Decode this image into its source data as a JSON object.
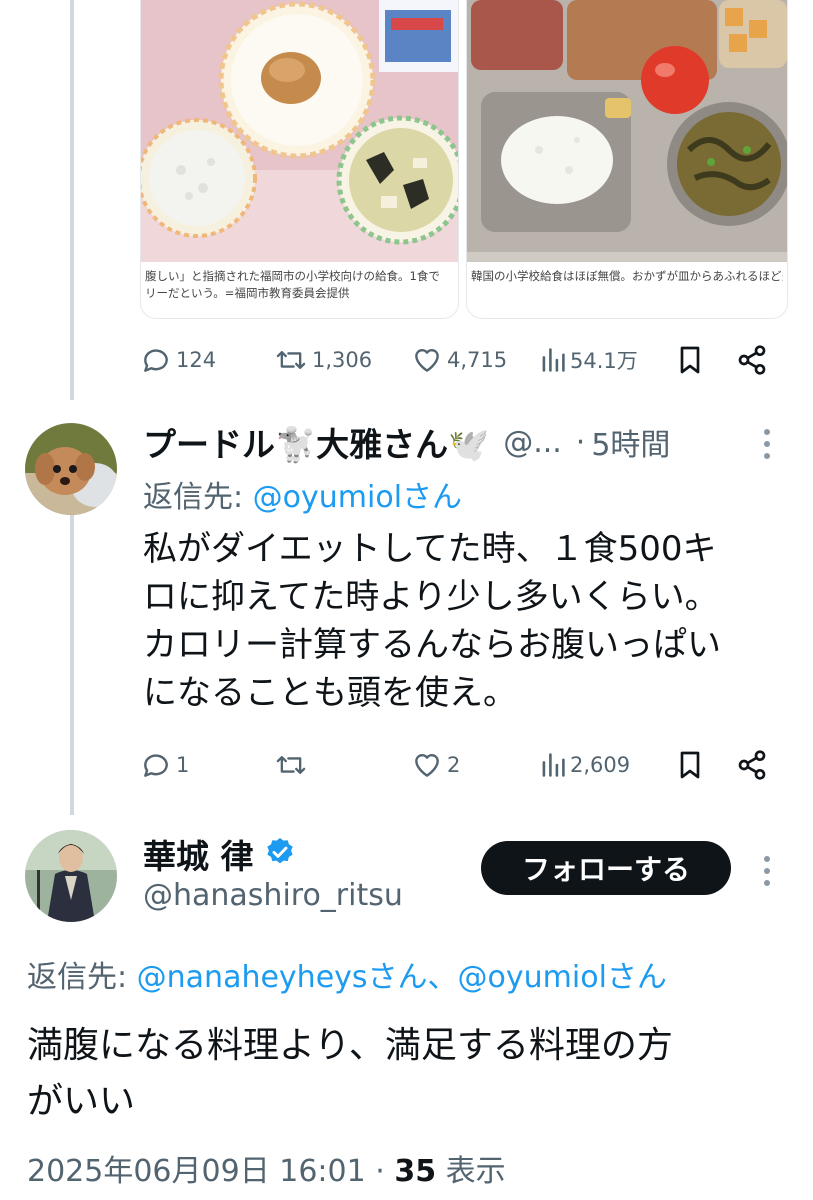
{
  "embedded_cards": {
    "left_caption_line1": "腹しい」と指摘された福岡市の小学校向けの給食。1食で",
    "left_caption_line2": "リーだという。=福岡市教育委員会提供",
    "right_caption": "韓国の小学校給食はほぼ無償。おかずが皿からあふれるほど多"
  },
  "first_post_actions": {
    "replies": "124",
    "reposts": "1,306",
    "likes": "4,715",
    "views": "54.1万"
  },
  "reply_post": {
    "display_name": "プードル🐩大雅さん🕊️",
    "handle": "@...",
    "separator": "·",
    "time": "5時間",
    "reply_label": "返信先:",
    "reply_mention": "@oyumiolさん",
    "text_line1": "私がダイエットしてた時、１食500キ",
    "text_line2": "ロに抑えてた時より少し多いくらい。",
    "text_line3": "カロリー計算するんならお腹いっぱい",
    "text_line4": "になることも頭を使え。",
    "actions": {
      "replies": "1",
      "reposts": "",
      "likes": "2",
      "views": "2,609"
    }
  },
  "main_post": {
    "display_name": "華城 律",
    "handle": "@hanashiro_ritsu",
    "follow_label": "フォローする",
    "reply_label": "返信先:",
    "reply_mentions": "@nanaheyheysさん、@oyumiolさん",
    "text_line1": "満腹になる料理より、満足する料理の方",
    "text_line2": "がいい",
    "timestamp": "2025年06月09日 16:01",
    "separator": "·",
    "view_count": "35",
    "view_label": "表示"
  },
  "icons": [
    "reply-icon",
    "repost-icon",
    "like-icon",
    "views-icon",
    "bookmark-icon",
    "share-icon",
    "more-icon",
    "verified-badge-icon"
  ],
  "colors": {
    "accent": "#1d9bf0",
    "muted": "#536471",
    "text": "#0f1419",
    "button": "#0f1419",
    "thread_line": "#cfd9de"
  }
}
